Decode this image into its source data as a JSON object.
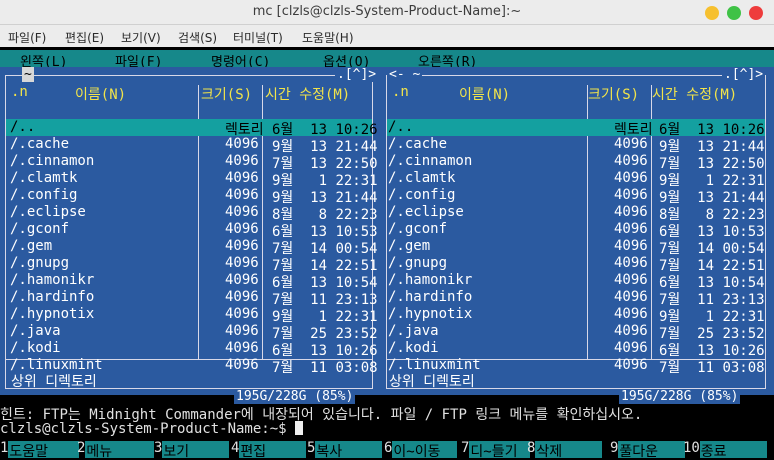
{
  "window": {
    "title": "mc [clzls@clzls-System-Product-Name]:~"
  },
  "menubar": [
    "파일(F)",
    "편집(E)",
    "보기(V)",
    "검색(S)",
    "터미널(T)",
    "도움말(H)"
  ],
  "mc_menu": [
    "왼쪽(L)",
    "파일(F)",
    "명령어(C)",
    "옵션(O)",
    "오른쪽(R)"
  ],
  "left_panel": {
    "path": "~",
    "indicator": ".[^]>",
    "col_n": ".n",
    "col_name": "이름(N)",
    "col_size": "크기(S)",
    "col_time": "시간 수정(M)",
    "rows": [
      {
        "name": "/..",
        "size": "렉토리",
        "date": "6월  13 10:26"
      },
      {
        "name": "/.cache",
        "size": "4096",
        "date": "9월  13 21:44"
      },
      {
        "name": "/.cinnamon",
        "size": "4096",
        "date": "7월  13 22:50"
      },
      {
        "name": "/.clamtk",
        "size": "4096",
        "date": "9월   1 22:31"
      },
      {
        "name": "/.config",
        "size": "4096",
        "date": "9월  13 21:44"
      },
      {
        "name": "/.eclipse",
        "size": "4096",
        "date": "8월   8 22:23"
      },
      {
        "name": "/.gconf",
        "size": "4096",
        "date": "6월  13 10:53"
      },
      {
        "name": "/.gem",
        "size": "4096",
        "date": "7월  14 00:54"
      },
      {
        "name": "/.gnupg",
        "size": "4096",
        "date": "7월  14 22:51"
      },
      {
        "name": "/.hamonikr",
        "size": "4096",
        "date": "6월  13 10:54"
      },
      {
        "name": "/.hardinfo",
        "size": "4096",
        "date": "7월  11 23:13"
      },
      {
        "name": "/.hypnotix",
        "size": "4096",
        "date": "9월   1 22:31"
      },
      {
        "name": "/.java",
        "size": "4096",
        "date": "7월  25 23:52"
      },
      {
        "name": "/.kodi",
        "size": "4096",
        "date": "6월  13 10:26"
      },
      {
        "name": "/.linuxmint",
        "size": "4096",
        "date": "7월  11 03:08"
      }
    ],
    "footer": "상위 디렉토리",
    "disk": "195G/228G (85%)"
  },
  "right_panel": {
    "path": "<- ~",
    "indicator": ".[^]>",
    "col_n": ".n",
    "col_name": "이름(N)",
    "col_size": "크기(S)",
    "col_time": "시간 수정(M)",
    "rows": [
      {
        "name": "/..",
        "size": "렉토리",
        "date": "6월  13 10:26"
      },
      {
        "name": "/.cache",
        "size": "4096",
        "date": "9월  13 21:44"
      },
      {
        "name": "/.cinnamon",
        "size": "4096",
        "date": "7월  13 22:50"
      },
      {
        "name": "/.clamtk",
        "size": "4096",
        "date": "9월   1 22:31"
      },
      {
        "name": "/.config",
        "size": "4096",
        "date": "9월  13 21:44"
      },
      {
        "name": "/.eclipse",
        "size": "4096",
        "date": "8월   8 22:23"
      },
      {
        "name": "/.gconf",
        "size": "4096",
        "date": "6월  13 10:53"
      },
      {
        "name": "/.gem",
        "size": "4096",
        "date": "7월  14 00:54"
      },
      {
        "name": "/.gnupg",
        "size": "4096",
        "date": "7월  14 22:51"
      },
      {
        "name": "/.hamonikr",
        "size": "4096",
        "date": "6월  13 10:54"
      },
      {
        "name": "/.hardinfo",
        "size": "4096",
        "date": "7월  11 23:13"
      },
      {
        "name": "/.hypnotix",
        "size": "4096",
        "date": "9월   1 22:31"
      },
      {
        "name": "/.java",
        "size": "4096",
        "date": "7월  25 23:52"
      },
      {
        "name": "/.kodi",
        "size": "4096",
        "date": "6월  13 10:26"
      },
      {
        "name": "/.linuxmint",
        "size": "4096",
        "date": "7월  11 03:08"
      }
    ],
    "footer": "상위 디렉토리",
    "disk": "195G/228G (85%)"
  },
  "hint": "힌트: FTP는 Midnight Commander에 내장되어 있습니다. 파일 / FTP 링크 메뉴를 확인하십시오.",
  "prompt": "clzls@clzls-System-Product-Name:~$ ",
  "fkeys": [
    {
      "n": "1",
      "label": "도움말"
    },
    {
      "n": "2",
      "label": "메뉴"
    },
    {
      "n": "3",
      "label": "보기"
    },
    {
      "n": "4",
      "label": "편집"
    },
    {
      "n": "5",
      "label": "복사"
    },
    {
      "n": "6",
      "label": "이~이동"
    },
    {
      "n": "7",
      "label": "디~들기"
    },
    {
      "n": "8",
      "label": "삭제"
    },
    {
      "n": "9",
      "label": "풀다운"
    },
    {
      "n": "10",
      "label": "종료"
    }
  ],
  "colors": {
    "panel_bg": "#2b5aa0",
    "cyan_bar": "#16888a",
    "header_yellow": "#f2e44a"
  }
}
